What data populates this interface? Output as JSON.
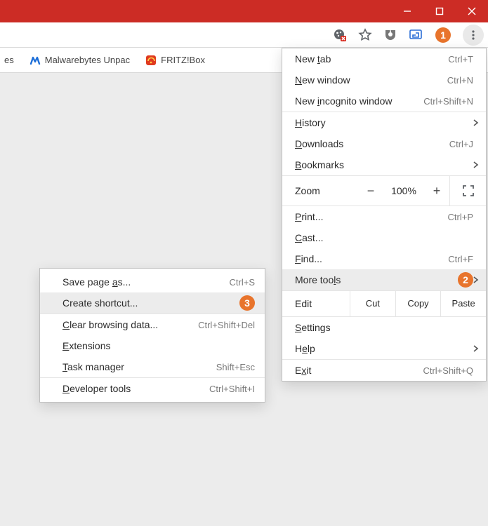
{
  "window": {
    "controls": {
      "minimize": "minimize",
      "maximize": "maximize",
      "close": "close"
    }
  },
  "toolbar": {
    "cookie_icon": "cookie-blocked-icon",
    "star_icon": "star-icon",
    "ublock_icon": "ublock-icon",
    "app_icon": "blue-app-icon",
    "profile_icon": "profile-icon",
    "menu_icon": "more-vert-icon"
  },
  "annotations": {
    "one": "1",
    "two": "2",
    "three": "3"
  },
  "bookmarks_bar": {
    "item_cut": "es",
    "items": [
      {
        "label": "Malwarebytes Unpac",
        "icon": "malwarebytes"
      },
      {
        "label": "FRITZ!Box",
        "icon": "fritzbox"
      }
    ]
  },
  "menu": {
    "new_tab": {
      "label": "New tab",
      "accel": "Ctrl+T"
    },
    "new_window": {
      "label": "New window",
      "accel": "Ctrl+N"
    },
    "new_incognito": {
      "label": "New incognito window",
      "accel": "Ctrl+Shift+N"
    },
    "history": {
      "label": "History"
    },
    "downloads": {
      "label": "Downloads",
      "accel": "Ctrl+J"
    },
    "bookmarks": {
      "label": "Bookmarks"
    },
    "zoom": {
      "label": "Zoom",
      "value": "100%",
      "minus": "−",
      "plus": "+"
    },
    "print": {
      "label": "Print...",
      "accel": "Ctrl+P"
    },
    "cast": {
      "label": "Cast..."
    },
    "find": {
      "label": "Find...",
      "accel": "Ctrl+F"
    },
    "more_tools": {
      "label": "More tools"
    },
    "edit": {
      "label": "Edit",
      "cut": "Cut",
      "copy": "Copy",
      "paste": "Paste"
    },
    "settings": {
      "label": "Settings"
    },
    "help": {
      "label": "Help"
    },
    "exit": {
      "label": "Exit",
      "accel": "Ctrl+Shift+Q"
    }
  },
  "submenu": {
    "save_page": {
      "label": "Save page as...",
      "accel": "Ctrl+S"
    },
    "create_shortcut": {
      "label": "Create shortcut..."
    },
    "clear_data": {
      "label": "Clear browsing data...",
      "accel": "Ctrl+Shift+Del"
    },
    "extensions": {
      "label": "Extensions"
    },
    "task_manager": {
      "label": "Task manager",
      "accel": "Shift+Esc"
    },
    "dev_tools": {
      "label": "Developer tools",
      "accel": "Ctrl+Shift+I"
    }
  }
}
